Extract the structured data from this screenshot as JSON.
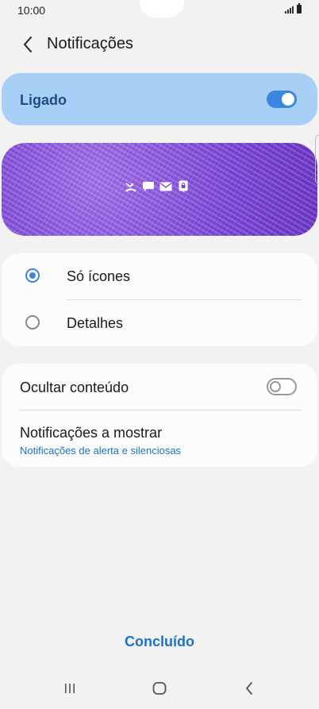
{
  "status_bar": {
    "time": "10:00"
  },
  "header": {
    "title": "Notificações"
  },
  "master_toggle": {
    "label": "Ligado",
    "state": "on"
  },
  "preview": {
    "icons": [
      "missed-call-icon",
      "message-icon",
      "email-icon",
      "lock-notification-icon"
    ]
  },
  "style_options": [
    {
      "label": "Só ícones",
      "selected": true
    },
    {
      "label": "Detalhes",
      "selected": false
    }
  ],
  "settings": {
    "hide_content": {
      "label": "Ocultar conteúdo",
      "state": "off"
    },
    "notifications_to_show": {
      "label": "Notificações a mostrar",
      "value": "Notificações de alerta e silenciosas"
    }
  },
  "footer": {
    "done_label": "Concluído"
  },
  "colors": {
    "accent": "#3a86e0",
    "link": "#1a73c8",
    "enabled_card": "#a8d0f7"
  }
}
